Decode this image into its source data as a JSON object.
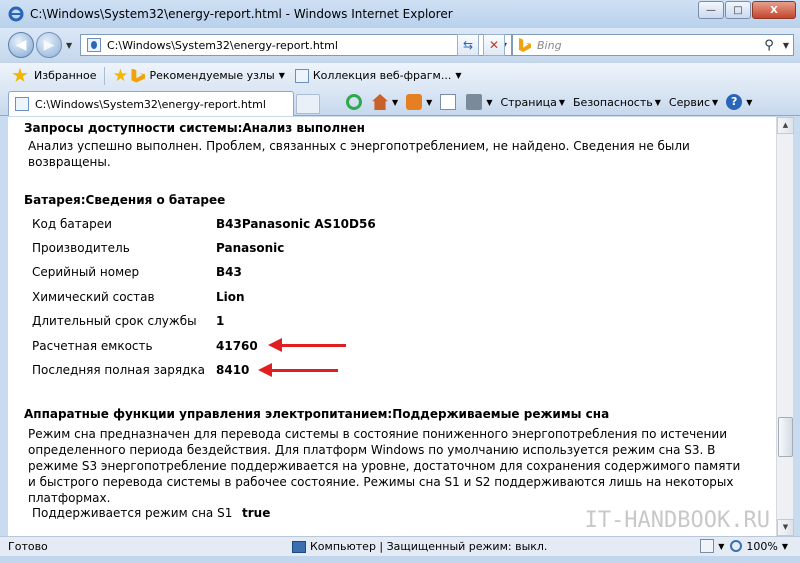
{
  "window": {
    "title": "C:\\Windows\\System32\\energy-report.html - Windows Internet Explorer",
    "minimize": "—",
    "maximize": "□",
    "close": "X"
  },
  "navbar": {
    "back_icon": "back-arrow",
    "forward_icon": "forward-arrow",
    "address": "C:\\Windows\\System32\\energy-report.html",
    "search_placeholder": "Bing",
    "refresh_glyph": "⇆",
    "stop_glyph": "✕",
    "search_glyph": "⚲"
  },
  "favorites": {
    "label": "Избранное",
    "items": [
      {
        "label": "Рекомендуемые узлы"
      },
      {
        "label": "Коллекция веб-фрагм..."
      }
    ]
  },
  "tab": {
    "label": "C:\\Windows\\System32\\energy-report.html"
  },
  "commands": {
    "page": "Страница",
    "safety": "Безопасность",
    "service": "Сервис",
    "help_glyph": "?"
  },
  "report": {
    "availability": {
      "title": "Запросы доступности системы:Анализ выполнен",
      "text": "Анализ успешно выполнен. Проблем, связанных с энергопотреблением, не найдено. Сведения не были возвращены."
    },
    "battery": {
      "title": "Батарея:Сведения о батарее",
      "rows": [
        {
          "label": "Код батареи",
          "value": "B43Panasonic AS10D56"
        },
        {
          "label": "Производитель",
          "value": "Panasonic"
        },
        {
          "label": "Серийный номер",
          "value": "B43"
        },
        {
          "label": "Химический состав",
          "value": "Lion"
        },
        {
          "label": "Длительный срок службы",
          "value": "1"
        },
        {
          "label": "Расчетная емкость",
          "value": "41760"
        },
        {
          "label": "Последняя полная зарядка",
          "value": "8410"
        }
      ]
    },
    "sleep": {
      "title": "Аппаратные функции управления электропитанием:Поддерживаемые режимы сна",
      "text": "Режим сна предназначен для перевода системы в состояние пониженного энергопотребления по истечении определенного периода бездействия. Для платформ Windows по умолчанию используется режим сна S3. В режиме S3 энергопотребление поддерживается на уровне, достаточном для сохранения содержимого памяти и быстрого перевода системы в рабочее состояние. Режимы сна S1 и S2 поддерживаются лишь на некоторых платформах.",
      "row_label": "Поддерживается режим сна S1",
      "row_value": "true"
    }
  },
  "watermark": "IT-HANDBOOK.RU",
  "statusbar": {
    "ready": "Готово",
    "zone": "Компьютер | Защищенный режим: выкл.",
    "zoom": "100%"
  },
  "colors": {
    "arrow": "#e02020",
    "chrome": "#c9dbef"
  }
}
